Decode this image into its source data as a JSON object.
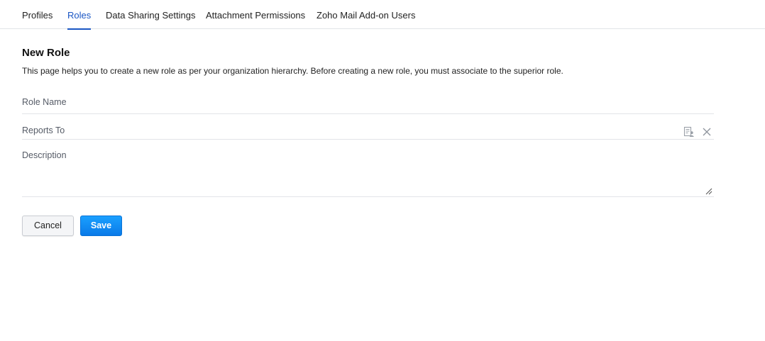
{
  "tabs": [
    {
      "label": "Profiles",
      "active": false
    },
    {
      "label": "Roles",
      "active": true
    },
    {
      "label": "Data Sharing Settings",
      "active": false
    },
    {
      "label": "Attachment Permissions",
      "active": false
    },
    {
      "label": "Zoho Mail Add-on Users",
      "active": false
    }
  ],
  "page": {
    "title": "New Role",
    "description": "This page helps you to create a new role as per your organization hierarchy. Before creating a new role, you must associate to the superior role."
  },
  "form": {
    "role_name": {
      "label": "Role Name",
      "value": ""
    },
    "reports_to": {
      "label": "Reports To",
      "value": "",
      "lookup_icon": "role-lookup-icon",
      "clear_icon": "close-icon"
    },
    "description": {
      "label": "Description",
      "value": ""
    }
  },
  "actions": {
    "cancel_label": "Cancel",
    "save_label": "Save"
  },
  "colors": {
    "accent": "#1a56c4",
    "save_button": "#0a7ae8",
    "divider": "#e2e4e8"
  }
}
